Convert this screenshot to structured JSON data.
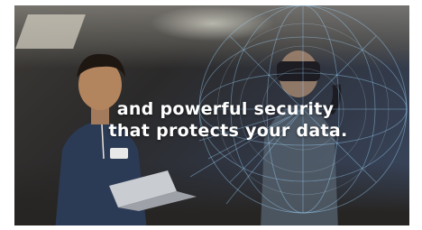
{
  "video": {
    "caption_line1": "and powerful security",
    "caption_line2": "that protects your data."
  },
  "colors": {
    "caption_text": "#ffffff",
    "hologram": "#9fd8ff",
    "background_dark": "#2b2a2a"
  },
  "icons": {
    "hologram_graphic": "wireframe-globe-icon"
  }
}
